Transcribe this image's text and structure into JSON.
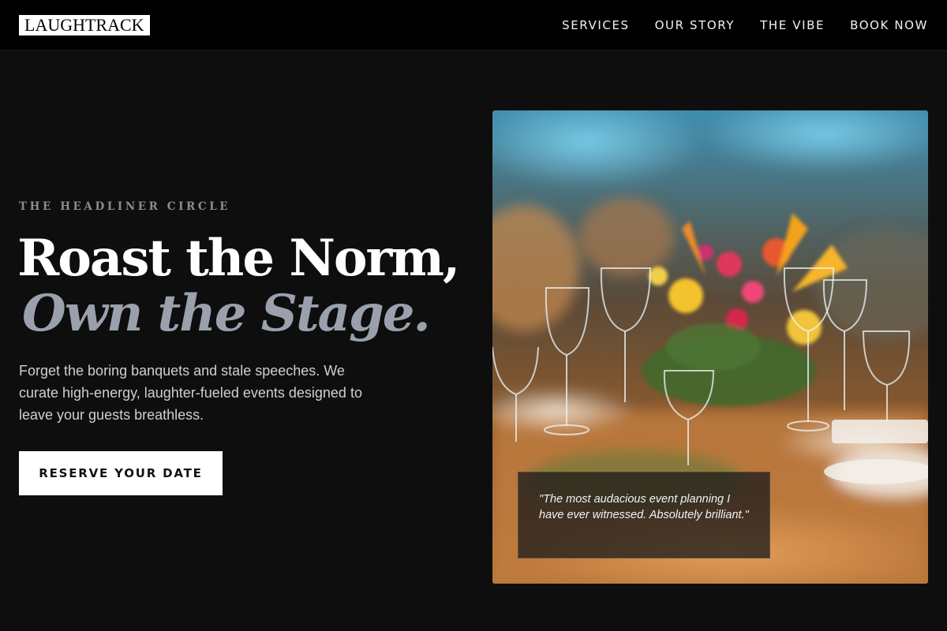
{
  "header": {
    "logo": "LAUGHTRACK",
    "nav": [
      {
        "label": "SERVICES"
      },
      {
        "label": "OUR STORY"
      },
      {
        "label": "THE VIBE"
      },
      {
        "label": "BOOK NOW"
      }
    ]
  },
  "hero": {
    "eyebrow": "THE HEADLINER CIRCLE",
    "headline_line1": "Roast the Norm,",
    "headline_line2": "Own the Stage.",
    "lead": "Forget the boring banquets and stale speeches. We curate high-energy, laughter-fueled events designed to leave your guests breathless.",
    "cta_label": "RESERVE YOUR DATE"
  },
  "testimonial": {
    "quote": "\"The most audacious event planning I have ever witnessed. Absolutely brilliant.\""
  },
  "colors": {
    "page_bg": "#0e0e0e",
    "header_bg": "#000000",
    "accent_muted": "#9aa1ad",
    "cta_bg": "#ffffff"
  },
  "icons": {
    "hero_image": "banquet-table-photo"
  }
}
